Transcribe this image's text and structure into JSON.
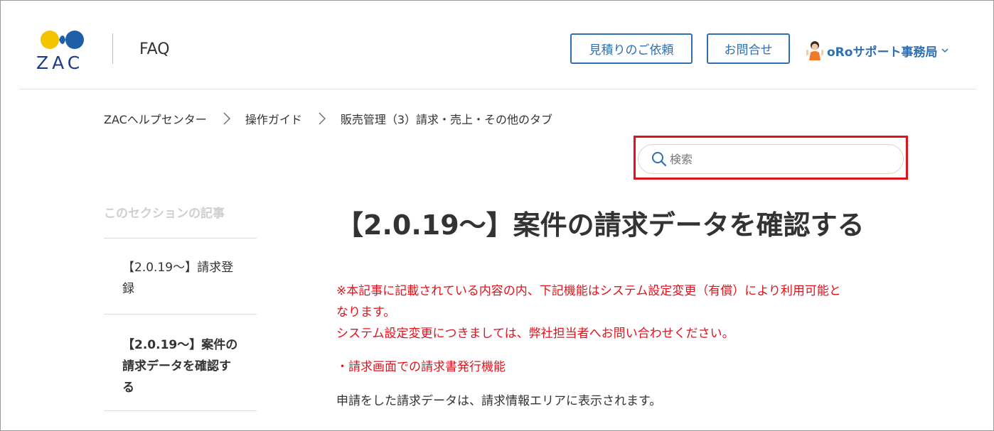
{
  "header": {
    "logo_text": "ZAC",
    "section_title": "FAQ",
    "quote_button": "見積りのご依頼",
    "contact_button": "お問合せ",
    "user_name": "oRoサポート事務局",
    "colors": {
      "accent": "#2e6fb0",
      "logo_navy": "#1e3a8a",
      "logo_yellow": "#f5c400",
      "logo_blue": "#1f5fa8"
    }
  },
  "breadcrumb": {
    "items": [
      "ZACヘルプセンター",
      "操作ガイド",
      "販売管理（3）請求・売上・その他のタブ"
    ]
  },
  "search": {
    "placeholder": "検索",
    "value": "",
    "highlight_color": "#e0121c"
  },
  "sidebar": {
    "heading": "このセクションの記事",
    "items": [
      {
        "label": "【2.0.19～】請求登録",
        "active": false
      },
      {
        "label": "【2.0.19～】案件の請求データを確認する",
        "active": true
      }
    ]
  },
  "article": {
    "title": "【2.0.19～】案件の請求データを確認する",
    "notice_line1": "※本記事に記載されている内容の内、下記機能はシステム設定変更（有償）により利用可能と",
    "notice_line2": "なります。",
    "notice_line3": "システム設定変更につきましては、弊社担当者へお問い合わせください。",
    "feature_item": "・請求画面での請求書発行機能",
    "body": "申請をした請求データは、請求情報エリアに表示されます。",
    "notice_color": "#e0121c"
  }
}
